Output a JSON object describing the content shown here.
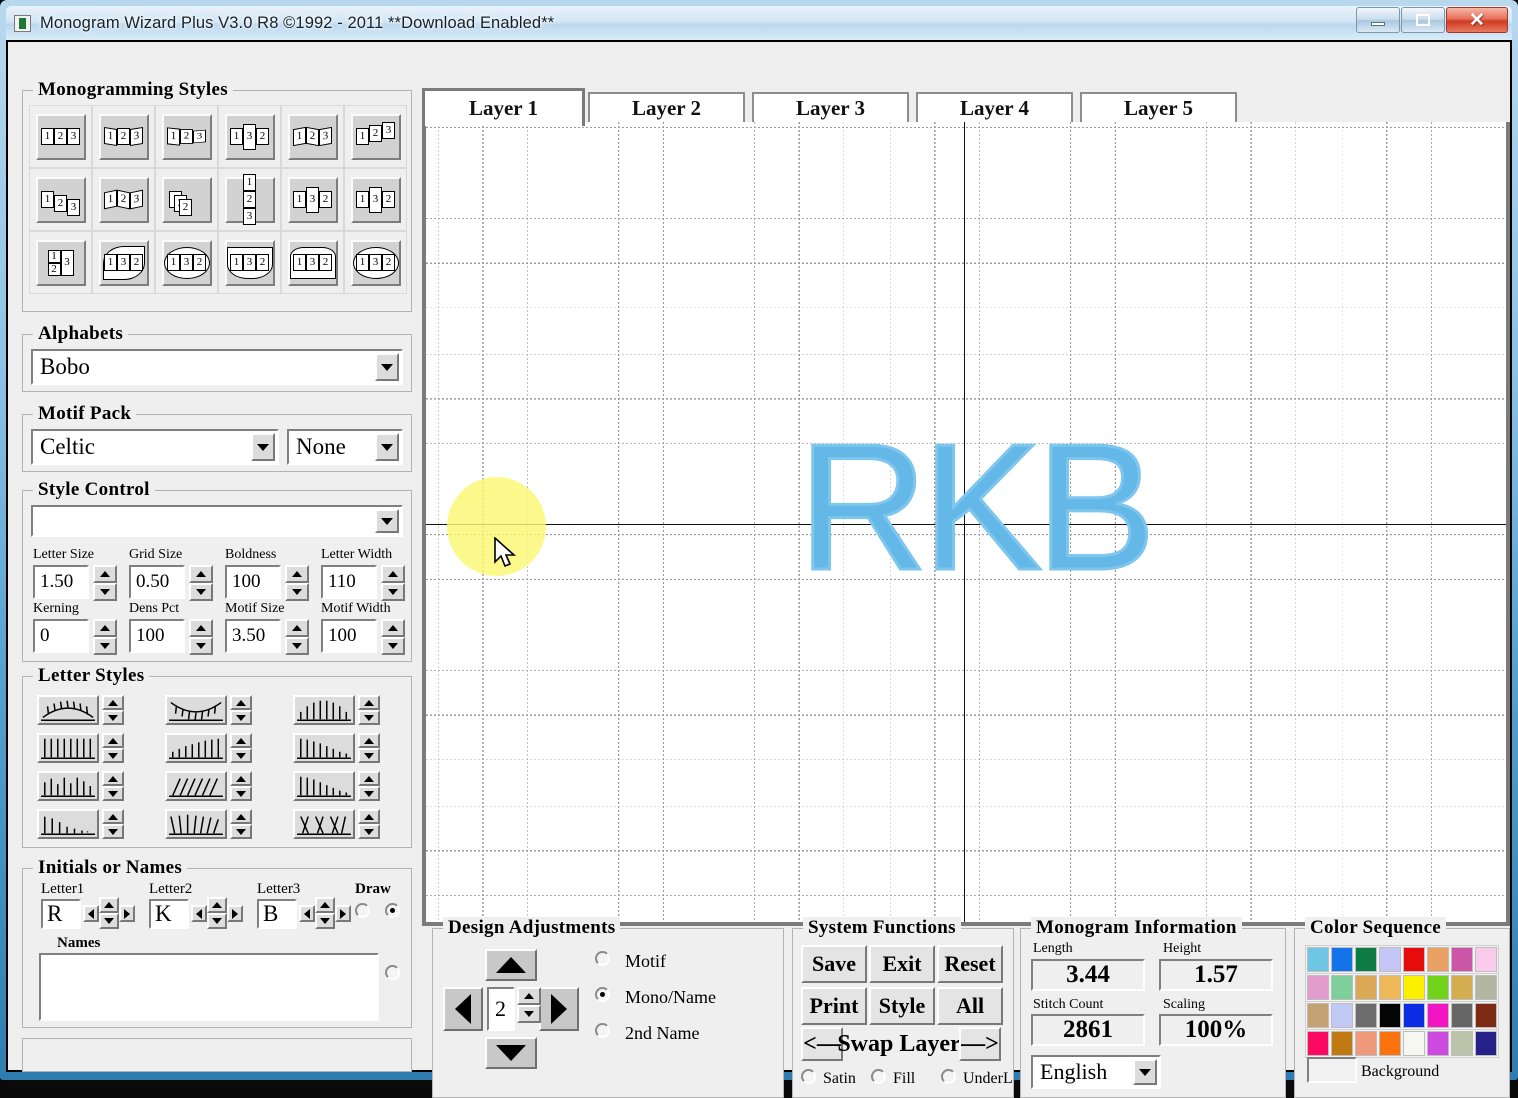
{
  "window": {
    "title": "Monogram Wizard Plus V3.0 R8 ©1992 - 2011  **Download Enabled**",
    "minimize_label": "Minimize",
    "maximize_label": "Maximize",
    "close_label": "✕"
  },
  "monogramming_styles": {
    "legend": "Monogramming Styles",
    "cells": [
      {
        "name": "style-1-2-3-flat",
        "layout": "flat",
        "digits": [
          "1",
          "2",
          "3"
        ]
      },
      {
        "name": "style-arc-fan",
        "layout": "fan",
        "digits": [
          "1",
          "2",
          "3"
        ]
      },
      {
        "name": "style-taper-right",
        "layout": "taper",
        "digits": [
          "1",
          "2",
          "3"
        ]
      },
      {
        "name": "style-center-tall",
        "layout": "centertall",
        "digits": [
          "1",
          "3",
          "2"
        ]
      },
      {
        "name": "style-wave",
        "layout": "wave",
        "digits": [
          "1",
          "2",
          "3"
        ]
      },
      {
        "name": "style-rise",
        "layout": "rise",
        "digits": [
          "1",
          "2",
          "3"
        ]
      },
      {
        "name": "style-descend",
        "layout": "descend",
        "digits": [
          "1",
          "2",
          "3"
        ]
      },
      {
        "name": "style-zigzag",
        "layout": "zigzag",
        "digits": [
          "1",
          "2",
          "3"
        ]
      },
      {
        "name": "style-overlap",
        "layout": "overlap",
        "digits": [
          "1",
          "3",
          "2"
        ]
      },
      {
        "name": "style-stacked",
        "layout": "stack",
        "digits": [
          "1",
          "2",
          "3"
        ]
      },
      {
        "name": "style-center-raised",
        "layout": "centerraise",
        "digits": [
          "1",
          "3",
          "2"
        ]
      },
      {
        "name": "style-center-block",
        "layout": "centerblock",
        "digits": [
          "1",
          "3",
          "2"
        ]
      },
      {
        "name": "style-split-left",
        "layout": "splitleft",
        "digits": [
          "1",
          "2",
          "3"
        ]
      },
      {
        "name": "style-diamond",
        "layout": "diamond",
        "digits": [
          "1",
          "3",
          "2"
        ]
      },
      {
        "name": "style-circle",
        "layout": "circle",
        "digits": [
          "1",
          "3",
          "2"
        ]
      },
      {
        "name": "style-shield",
        "layout": "shield",
        "digits": [
          "1",
          "3",
          "2"
        ]
      },
      {
        "name": "style-pentagon",
        "layout": "pentagon",
        "digits": [
          "1",
          "3",
          "2"
        ]
      },
      {
        "name": "style-ellipse",
        "layout": "ellipse",
        "digits": [
          "1",
          "3",
          "2"
        ]
      }
    ]
  },
  "alphabets": {
    "legend": "Alphabets",
    "value": "Bobo"
  },
  "motif_pack": {
    "legend": "Motif Pack",
    "pack": "Celtic",
    "variant": "None"
  },
  "style_control": {
    "legend": "Style Control",
    "selected": "",
    "fields": [
      {
        "label": "Letter Size",
        "value": "1.50",
        "name": "letter-size"
      },
      {
        "label": "Grid Size",
        "value": "0.50",
        "name": "grid-size"
      },
      {
        "label": "Boldness",
        "value": "100",
        "name": "boldness"
      },
      {
        "label": "Letter Width",
        "value": "110",
        "name": "letter-width"
      },
      {
        "label": "Kerning",
        "value": "0",
        "name": "kerning"
      },
      {
        "label": "Dens Pct",
        "value": "100",
        "name": "dens-pct"
      },
      {
        "label": "Motif Size",
        "value": "3.50",
        "name": "motif-size"
      },
      {
        "label": "Motif Width",
        "value": "100",
        "name": "motif-width"
      }
    ]
  },
  "letter_styles": {
    "legend": "Letter Styles",
    "buttons": [
      {
        "name": "letter-style-arc-up",
        "glyph": "arc-up"
      },
      {
        "name": "letter-style-arc-down",
        "glyph": "arc-down"
      },
      {
        "name": "letter-style-bulge",
        "glyph": "bulge"
      },
      {
        "name": "letter-style-flat",
        "glyph": "flat"
      },
      {
        "name": "letter-style-ramp-up",
        "glyph": "ramp-up"
      },
      {
        "name": "letter-style-ramp-down",
        "glyph": "ramp-down"
      },
      {
        "name": "letter-style-wave",
        "glyph": "wave"
      },
      {
        "name": "letter-style-slant",
        "glyph": "slant"
      },
      {
        "name": "letter-style-taper",
        "glyph": "taper"
      },
      {
        "name": "letter-style-fade",
        "glyph": "fade"
      },
      {
        "name": "letter-style-fan",
        "glyph": "fan"
      },
      {
        "name": "letter-style-splay",
        "glyph": "splay"
      }
    ]
  },
  "initials": {
    "legend": "Initials or Names",
    "letter1_label": "Letter1",
    "letter2_label": "Letter2",
    "letter3_label": "Letter3",
    "letter1": "R",
    "letter2": "K",
    "letter3": "B",
    "draw_label": "Draw",
    "names_label": "Names",
    "names_value": ""
  },
  "layers": {
    "tabs": [
      {
        "label": "Layer 1",
        "active": true
      },
      {
        "label": "Layer 2",
        "active": false
      },
      {
        "label": "Layer 3",
        "active": false
      },
      {
        "label": "Layer 4",
        "active": false
      },
      {
        "label": "Layer 5",
        "active": false
      }
    ]
  },
  "canvas": {
    "monogram_text": "RKB",
    "monogram_color": "#63b8e8",
    "grid_color": "#9a9a9a",
    "axis_color": "#111111",
    "cursor_highlight_color": "#faf871"
  },
  "design_adjustments": {
    "legend": "Design Adjustments",
    "step_value": "2",
    "up_label": "Move up",
    "down_label": "Move down",
    "left_label": "Move left",
    "right_label": "Move right",
    "radios": [
      {
        "label": "Motif",
        "selected": false
      },
      {
        "label": "Mono/Name",
        "selected": true
      },
      {
        "label": "2nd Name",
        "selected": false
      }
    ]
  },
  "system_functions": {
    "legend": "System Functions",
    "buttons": [
      {
        "label": "Save",
        "name": "save-button"
      },
      {
        "label": "Exit",
        "name": "exit-button"
      },
      {
        "label": "Reset",
        "name": "reset-button"
      },
      {
        "label": "Print",
        "name": "print-button"
      },
      {
        "label": "Style",
        "name": "style-button"
      },
      {
        "label": "All",
        "name": "all-button"
      }
    ],
    "swap_layer_label": "Swap Layer",
    "swap_prev": "<—",
    "swap_next": "—>",
    "radios": [
      {
        "label": "Satin",
        "selected": false
      },
      {
        "label": "Fill",
        "selected": false
      },
      {
        "label": "UnderL",
        "selected": false
      }
    ]
  },
  "monogram_information": {
    "legend": "Monogram Information",
    "length_label": "Length",
    "length_value": "3.44",
    "height_label": "Height",
    "height_value": "1.57",
    "stitch_label": "Stitch Count",
    "stitch_value": "2861",
    "scaling_label": "Scaling",
    "scaling_value": "100%",
    "language": "English"
  },
  "color_sequence": {
    "legend": "Color Sequence",
    "background_label": "Background",
    "background_color": "#f1f1f1",
    "rows": [
      [
        "#6ec6e4",
        "#1373e8",
        "#0d7b43",
        "#c3c6f5",
        "#e60c0c",
        "#e8a063",
        "#cc55a8",
        "#f9cced"
      ],
      [
        "#e29ccd",
        "#7fcf9b",
        "#dba855",
        "#eeb757",
        "#fbf000",
        "#71d31a",
        "#d4ae4e",
        "#b3b7a2"
      ],
      [
        "#c4a273",
        "#c3c9f7",
        "#6d6d6d",
        "#040404",
        "#0a2ce2",
        "#f215c4",
        "#666666",
        "#7d2a15"
      ],
      [
        "#fb0a62",
        "#c17a12",
        "#f0997a",
        "#fa730c",
        "#f7f7f2",
        "#cd4ae0",
        "#bdc3ab",
        "#262189"
      ]
    ]
  }
}
